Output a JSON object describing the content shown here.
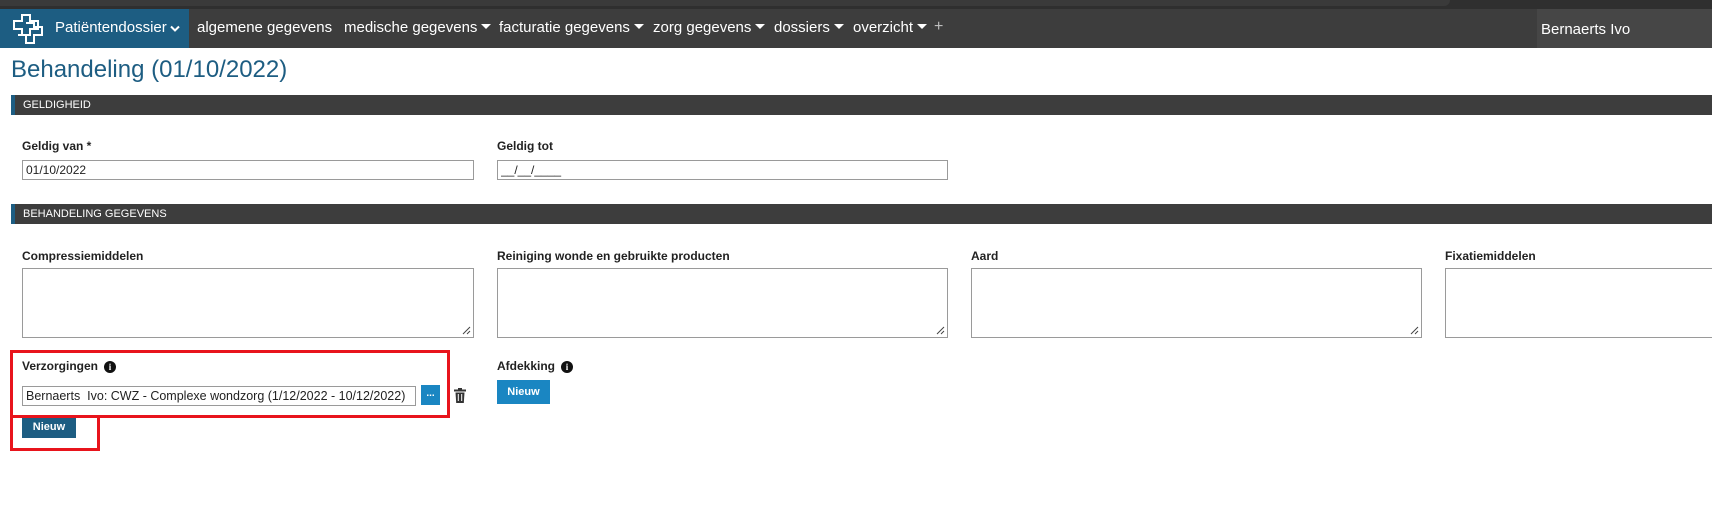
{
  "navbar": {
    "brand_label": "Patiëntendossier",
    "items": [
      {
        "label": "algemene gegevens",
        "has_caret": false
      },
      {
        "label": "medische gegevens",
        "has_caret": true
      },
      {
        "label": "facturatie gegevens",
        "has_caret": true
      },
      {
        "label": "zorg gegevens",
        "has_caret": true
      },
      {
        "label": "dossiers",
        "has_caret": true
      },
      {
        "label": "overzicht",
        "has_caret": true
      }
    ],
    "plus_label": "+",
    "user_label": "Bernaerts  Ivo"
  },
  "page": {
    "title": "Behandeling (01/10/2022)"
  },
  "geldigheid": {
    "header": "GELDIGHEID",
    "geldig_van_label": "Geldig van *",
    "geldig_van_value": "01/10/2022",
    "geldig_tot_label": "Geldig tot",
    "geldig_tot_value": "__/__/____"
  },
  "behandeling": {
    "header": "BEHANDELING GEGEVENS",
    "compressie_label": "Compressiemiddelen",
    "reiniging_label": "Reiniging wonde en gebruikte producten",
    "aard_label": "Aard",
    "fixatie_label": "Fixatiemiddelen",
    "verzorgingen_label": "Verzorgingen",
    "verzorgingen_value": "Bernaerts  Ivo: CWZ - Complexe wondzorg (1/12/2022 - 10/12/2022)",
    "browse_label": "...",
    "verzorgingen_new_label": "Nieuw",
    "afdekking_label": "Afdekking",
    "afdekking_new_label": "Nieuw"
  },
  "colors": {
    "brand": "#1d5d82",
    "navbar": "#3d3d3d",
    "button_blue": "#1a86c2",
    "highlight": "#e8141c"
  }
}
